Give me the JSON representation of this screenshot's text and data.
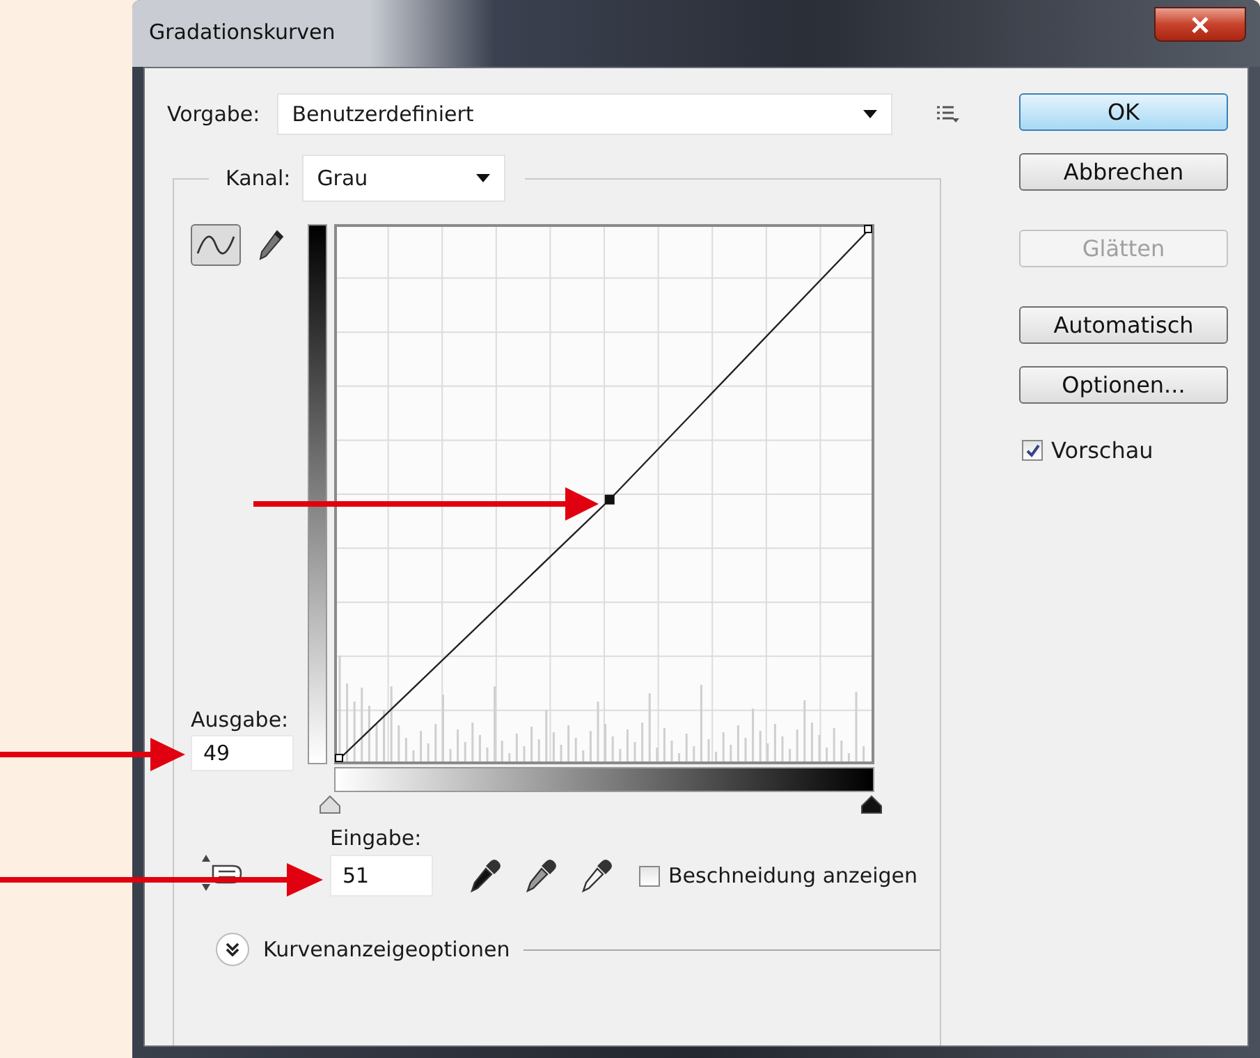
{
  "window": {
    "title": "Gradationskurven"
  },
  "preset": {
    "label": "Vorgabe:",
    "value": "Benutzerdefiniert"
  },
  "channel": {
    "label": "Kanal:",
    "value": "Grau"
  },
  "tools": [
    {
      "kind": "curve",
      "selected": true
    },
    {
      "kind": "pencil",
      "selected": false
    }
  ],
  "output": {
    "label": "Ausgabe:",
    "value": "49"
  },
  "input": {
    "label": "Eingabe:",
    "value": "51"
  },
  "eyedroppers": [
    {
      "kind": "black"
    },
    {
      "kind": "gray"
    },
    {
      "kind": "white"
    }
  ],
  "clipping": {
    "label": "Beschneidung anzeigen",
    "checked": false
  },
  "display_options": {
    "label": "Kurvenanzeigeoptionen",
    "expanded": false
  },
  "buttons": [
    {
      "label": "OK",
      "default": true,
      "disabled": false
    },
    {
      "label": "Abbrechen",
      "default": false,
      "disabled": false
    },
    {
      "label": "Glätten",
      "default": false,
      "disabled": true
    },
    {
      "label": "Automatisch",
      "default": false,
      "disabled": false
    },
    {
      "label": "Optionen...",
      "default": false,
      "disabled": false
    }
  ],
  "preview": {
    "label": "Vorschau",
    "checked": true
  }
}
